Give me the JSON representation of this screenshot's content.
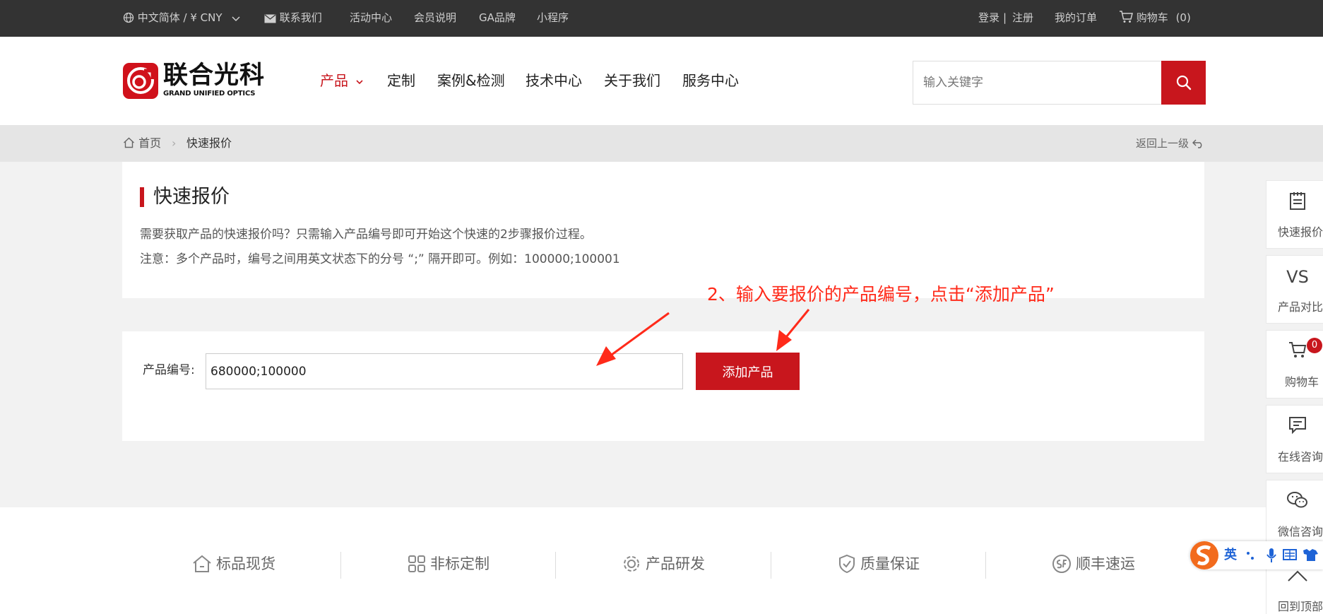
{
  "topbar": {
    "language": "中文简体 / ¥ CNY",
    "contact": "联系我们",
    "activity": "活动中心",
    "member": "会员说明",
    "ga_brand": "GA品牌",
    "mini_program": "小程序",
    "login": "登录",
    "separator": "|",
    "register": "注册",
    "orders": "我的订单",
    "cart": "购物车",
    "cart_count": "(0)"
  },
  "logo": {
    "cn": "联合光科",
    "en": "GRAND UNIFIED OPTICS"
  },
  "nav": {
    "products": "产品",
    "custom": "定制",
    "cases": "案例&检测",
    "tech": "技术中心",
    "about": "关于我们",
    "service": "服务中心"
  },
  "search": {
    "placeholder": "输入关键字"
  },
  "breadcrumb": {
    "home": "首页",
    "current": "快速报价",
    "back": "返回上一级"
  },
  "quote": {
    "title": "快速报价",
    "desc1": "需要获取产品的快速报价吗？只需输入产品编号即可开始这个快速的2步骤报价过程。",
    "desc2": "注意：多个产品时，编号之间用英文状态下的分号 “;” 隔开即可。例如：100000;100001",
    "code_label": "产品编号:",
    "code_value": "680000;100000",
    "add_button": "添加产品"
  },
  "annotation": "2、输入要报价的产品编号，点击“添加产品”",
  "features": {
    "stock": "标品现货",
    "custom": "非标定制",
    "rd": "产品研发",
    "quality": "质量保证",
    "sf": "顺丰速运"
  },
  "rail": {
    "quick_quote": "快速报价",
    "compare_icon": "VS",
    "compare": "产品对比",
    "cart": "购物车",
    "cart_badge": "0",
    "online": "在线咨询",
    "wechat": "微信咨询",
    "top": "回到顶部"
  },
  "ime": {
    "lang": "英"
  },
  "colors": {
    "brand_red": "#c8161d",
    "topbar": "#333333",
    "annotation_red": "#ff2a1a"
  }
}
